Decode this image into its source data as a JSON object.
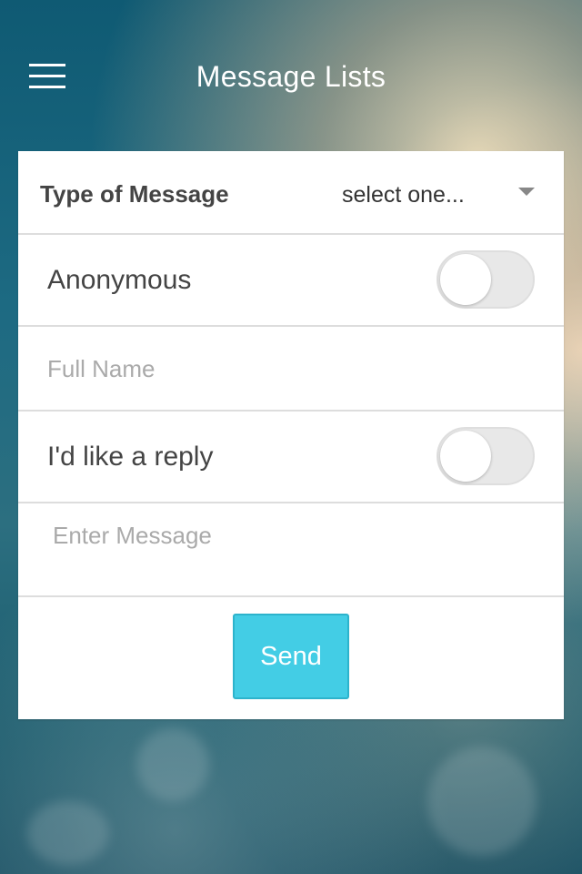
{
  "header": {
    "title": "Message Lists",
    "menu_icon": "hamburger-menu-icon"
  },
  "form": {
    "type_of_message": {
      "label": "Type of Message",
      "selected": "select one...",
      "icon": "chevron-down-icon"
    },
    "anonymous": {
      "label": "Anonymous",
      "on": false
    },
    "full_name": {
      "placeholder": "Full Name",
      "value": ""
    },
    "reply": {
      "label": "I'd like a reply",
      "on": false
    },
    "message": {
      "placeholder": "Enter Message",
      "value": ""
    },
    "send_label": "Send"
  },
  "colors": {
    "accent": "#43cde5",
    "background": "#1d6a82",
    "toggle_off": "#e8e8e8"
  }
}
